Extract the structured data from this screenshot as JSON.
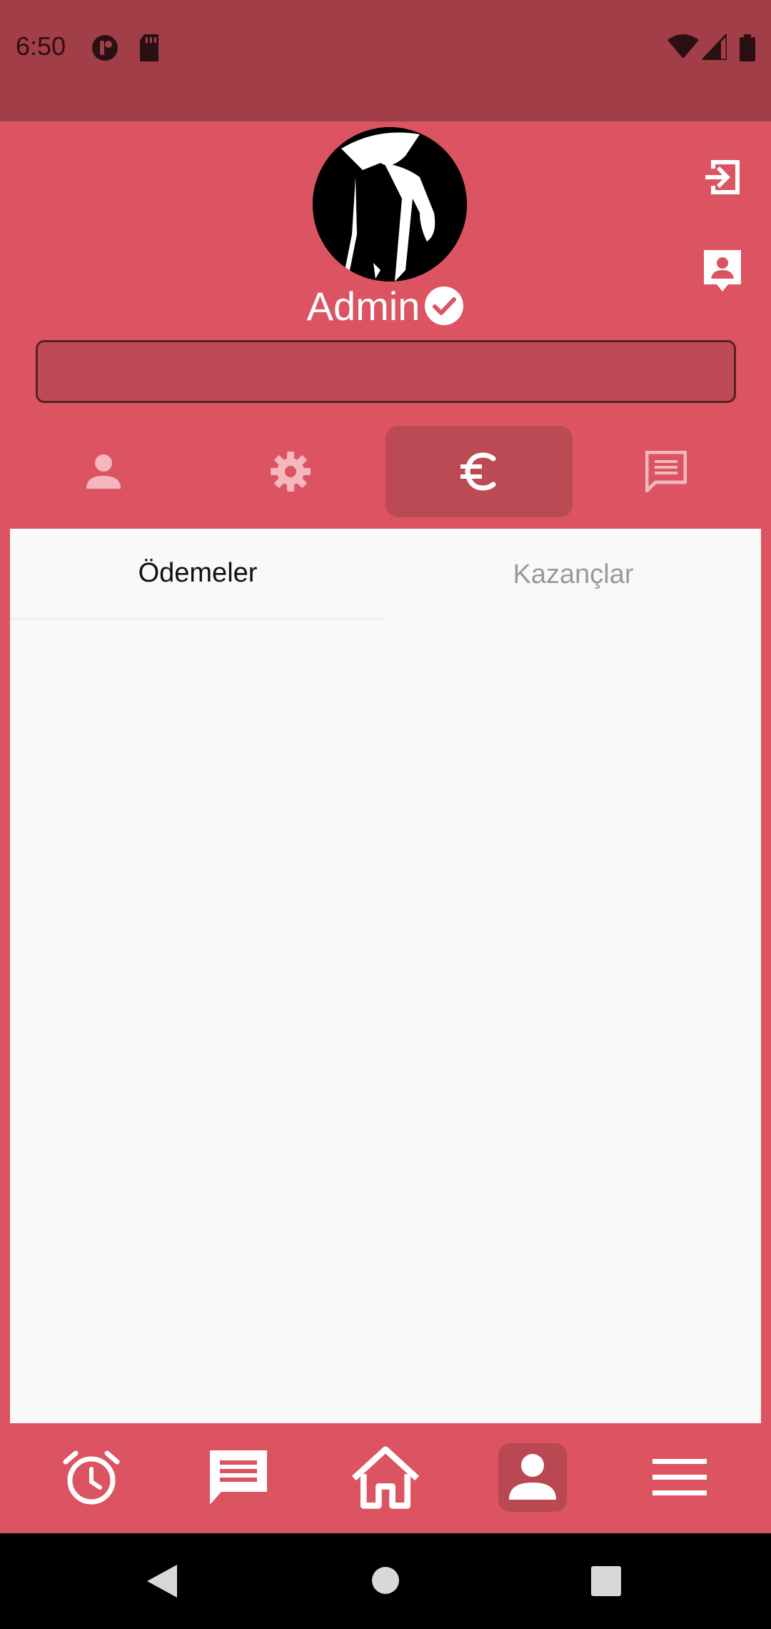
{
  "status_bar": {
    "time": "6:50",
    "left_icons": [
      "notification-icon",
      "sd-card-icon"
    ],
    "right_icons": [
      "wifi-icon",
      "signal-icon",
      "battery-icon"
    ]
  },
  "profile": {
    "username": "Admin",
    "verified_icon": "check-circle-icon",
    "bio_value": ""
  },
  "top_actions": [
    "login-icon",
    "contact-card-icon"
  ],
  "profile_tabs": [
    {
      "icon": "person-icon",
      "active": false
    },
    {
      "icon": "gear-icon",
      "active": false
    },
    {
      "icon": "euro-icon",
      "active": true
    },
    {
      "icon": "chat-icon",
      "active": false
    }
  ],
  "subtabs": [
    {
      "label": "Ödemeler",
      "active": true
    },
    {
      "label": "Kazançlar",
      "active": false
    }
  ],
  "bottom_nav": [
    {
      "icon": "alarm-clock-icon",
      "active": false
    },
    {
      "icon": "message-icon",
      "active": false
    },
    {
      "icon": "home-icon",
      "active": false
    },
    {
      "icon": "account-icon",
      "active": true
    },
    {
      "icon": "menu-icon",
      "active": false
    }
  ],
  "colors": {
    "status_bar": "#a23e48",
    "primary": "#dc5361",
    "active_tab": "#bc4a55",
    "content_bg": "#f9f9f9"
  }
}
